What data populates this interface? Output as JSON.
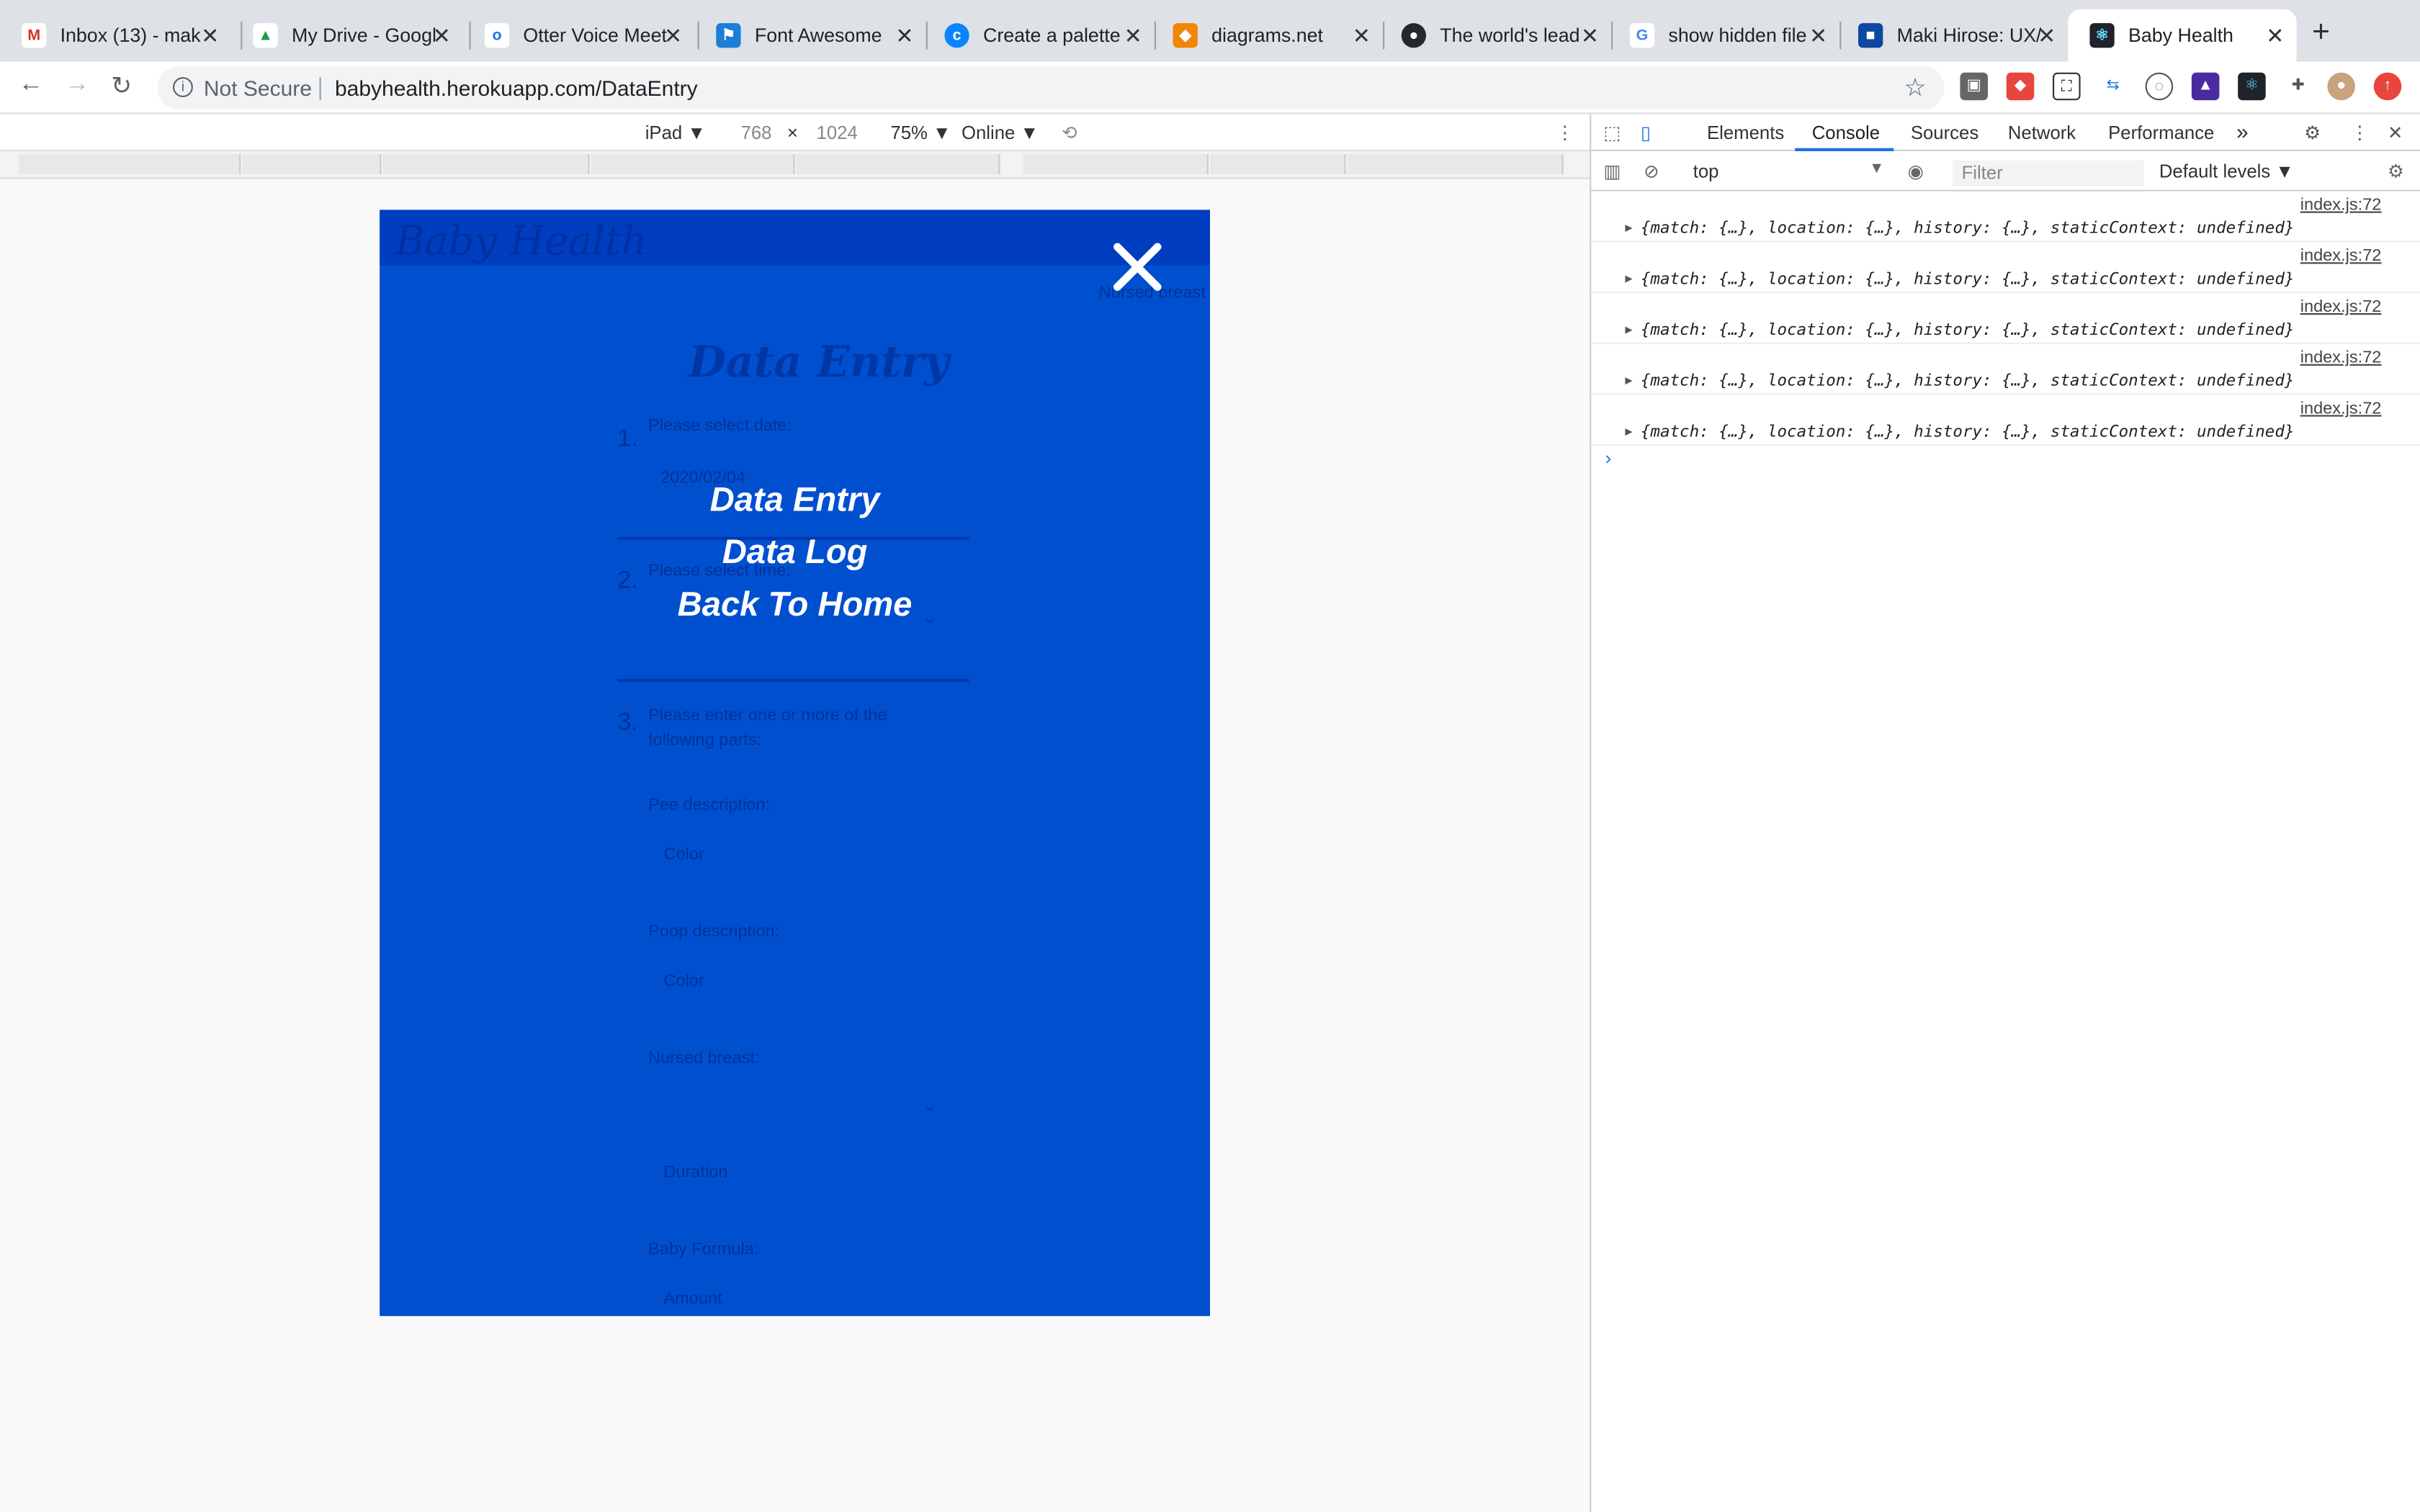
{
  "browser": {
    "tabs": [
      {
        "label": "Inbox (13) - mak",
        "icon": "gmail-icon",
        "color": "#d93025",
        "glyph": "M"
      },
      {
        "label": "My Drive - Googl",
        "icon": "drive-icon",
        "color": "#1a9a4a",
        "glyph": "▲"
      },
      {
        "label": "Otter Voice Meet",
        "icon": "otter-icon",
        "color": "#1a73e8",
        "glyph": "o"
      },
      {
        "label": "Font Awesome",
        "icon": "flag-icon",
        "color": "#1c7ed6",
        "glyph": "⚑"
      },
      {
        "label": "Create a palette",
        "icon": "coolors-icon",
        "color": "#0a84ff",
        "glyph": "c"
      },
      {
        "label": "diagrams.net",
        "icon": "diagrams-icon",
        "color": "#f08705",
        "glyph": "◆"
      },
      {
        "label": "The world's lead",
        "icon": "github-icon",
        "color": "#24292e",
        "glyph": "●"
      },
      {
        "label": "show hidden file",
        "icon": "google-icon",
        "color": "#4285f4",
        "glyph": "G"
      },
      {
        "label": "Maki Hirose: UX/",
        "icon": "portfolio-icon",
        "color": "#0d47a1",
        "glyph": "■"
      },
      {
        "label": "Baby Health",
        "icon": "react-icon",
        "color": "#20232a",
        "glyph": "⚛"
      }
    ],
    "new_tab": "+",
    "security": "Not Secure",
    "url": "babyhealth.herokuapp.com/DataEntry"
  },
  "device_toolbar": {
    "device": "iPad ▼",
    "width": "768",
    "x": "×",
    "height": "1024",
    "zoom": "75% ▼",
    "network": "Online ▼"
  },
  "app": {
    "brand": "Baby Health",
    "page_title": "Data Entry",
    "background": "#004fcf",
    "ghost": {
      "step1": "1.",
      "step1_label": "Please select date:",
      "date_value": "2020/02/04",
      "step2": "2.",
      "step2_label": "Please select time:",
      "step3": "3.",
      "step3_label": "Please enter one or more of the following parts:",
      "pee_label": "Pee description:",
      "pee_placeholder": "Color",
      "poop_label": "Poop description:",
      "poop_placeholder": "Color",
      "nursed_label": "Nursed breast:",
      "nursed_placeholder": "Duration",
      "formula_label": "Baby Formula:",
      "formula_placeholder": "Amount",
      "header_link": "Nursed breast"
    },
    "menu": [
      {
        "label": "Data Entry"
      },
      {
        "label": "Data Log"
      },
      {
        "label": "Back To Home"
      }
    ]
  },
  "devtools": {
    "tabs": [
      "Elements",
      "Console",
      "Sources",
      "Network",
      "Performance"
    ],
    "active_tab": "Console",
    "more": "»",
    "context": "top",
    "filter_placeholder": "Filter",
    "levels": "Default levels ▼",
    "logs": [
      {
        "source": "index.js:72",
        "text": "{match: {…}, location: {…}, history: {…}, staticContext: undefined}"
      },
      {
        "source": "index.js:72",
        "text": "{match: {…}, location: {…}, history: {…}, staticContext: undefined}"
      },
      {
        "source": "index.js:72",
        "text": "{match: {…}, location: {…}, history: {…}, staticContext: undefined}"
      },
      {
        "source": "index.js:72",
        "text": "{match: {…}, location: {…}, history: {…}, staticContext: undefined}"
      },
      {
        "source": "index.js:72",
        "text": "{match: {…}, location: {…}, history: {…}, staticContext: undefined}"
      }
    ],
    "prompt": "›"
  }
}
